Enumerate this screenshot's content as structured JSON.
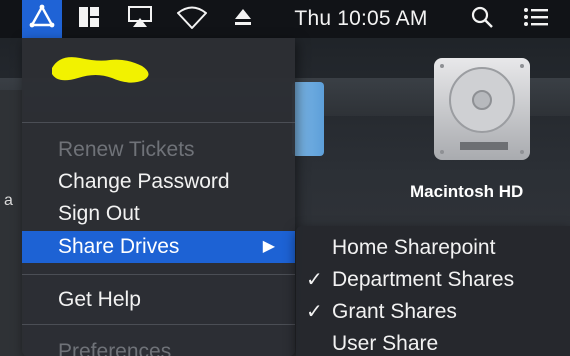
{
  "menubar": {
    "clock": "Thu 10:05 AM",
    "icons": [
      "app-triangle-icon",
      "layout-grid-icon",
      "airplay-icon",
      "wifi-icon",
      "eject-icon",
      "search-icon",
      "list-icon"
    ],
    "active_color": "#1f63d6"
  },
  "desktop": {
    "drive_label": "Macintosh HD",
    "partial_letter": "a"
  },
  "menu": {
    "user_name_redacted": "",
    "items": [
      {
        "label": "Renew Tickets",
        "enabled": false
      },
      {
        "label": "Change Password",
        "enabled": true
      },
      {
        "label": "Sign Out",
        "enabled": true
      },
      {
        "label": "Share Drives",
        "enabled": true,
        "highlighted": true,
        "submenu": true
      },
      {
        "label": "Get Help",
        "enabled": true
      },
      {
        "label": "Preferences",
        "enabled": false
      }
    ],
    "submenu_arrow": "▶",
    "highlight_color": "#1d62d4"
  },
  "submenu": {
    "check_glyph": "✓",
    "items": [
      {
        "label": "Home Sharepoint",
        "checked": false
      },
      {
        "label": "Department Shares",
        "checked": true
      },
      {
        "label": "Grant Shares",
        "checked": true
      },
      {
        "label": "User Share",
        "checked": false
      }
    ]
  }
}
